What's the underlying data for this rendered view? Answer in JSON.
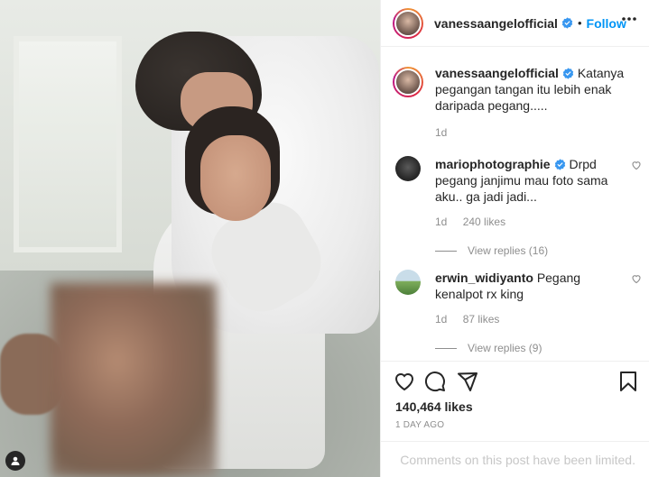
{
  "post": {
    "author": "vanessaangelofficial",
    "follow_label": "Follow",
    "separator": "•"
  },
  "caption": {
    "username": "vanessaangelofficial",
    "text": "Katanya pegangan tangan itu lebih enak daripada pegang.....",
    "age": "1d"
  },
  "comments": [
    {
      "username": "mariophotographie",
      "verified": true,
      "text": "Drpd pegang janjimu mau foto sama aku.. ga jadi jadi...",
      "age": "1d",
      "likes": "240 likes",
      "replies": "View replies (16)"
    },
    {
      "username": "erwin_widiyanto",
      "verified": false,
      "text": "Pegang kenalpot rx king",
      "age": "1d",
      "likes": "87 likes",
      "replies": "View replies (9)"
    }
  ],
  "stats": {
    "likes": "140,464 likes",
    "date": "1 DAY AGO"
  },
  "comment_box": {
    "limited_text": "Comments on this post have been limited."
  },
  "icons": {
    "verified": "verified-badge-icon",
    "more": "more-options-icon",
    "like": "heart-icon",
    "comment": "comment-icon",
    "share": "send-icon",
    "save": "bookmark-icon",
    "owner": "user-icon"
  },
  "colors": {
    "link_blue": "#0095f6",
    "verified_blue": "#3897f0",
    "muted": "#8e8e8e"
  }
}
